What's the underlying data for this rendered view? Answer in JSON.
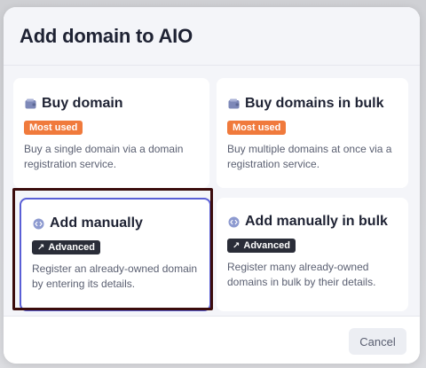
{
  "modal": {
    "title": "Add domain to AIO"
  },
  "cards": [
    {
      "title": "Buy domain",
      "icon": "wallet-icon",
      "badge": "Most used",
      "badge_icon": "",
      "description": "Buy a single domain via a domain registration service."
    },
    {
      "title": "Buy domains in bulk",
      "icon": "wallet-icon",
      "badge": "Most used",
      "badge_icon": "",
      "description": "Buy multiple domains at once via a registration service."
    },
    {
      "title": "Add manually",
      "icon": "code-icon",
      "badge": "Advanced",
      "badge_icon": "advanced-icon",
      "description": "Register an already-owned domain by entering its details."
    },
    {
      "title": "Add manually in bulk",
      "icon": "code-icon",
      "badge": "Advanced",
      "badge_icon": "advanced-icon",
      "description": "Register many already-owned domains in bulk by their details."
    }
  ],
  "footer": {
    "cancel_label": "Cancel"
  },
  "colors": {
    "badge_most_used": "#f07a3c",
    "badge_advanced": "#2a2d38",
    "selected_border": "#5a5fd6",
    "highlight_ring": "#3b0c0c"
  }
}
